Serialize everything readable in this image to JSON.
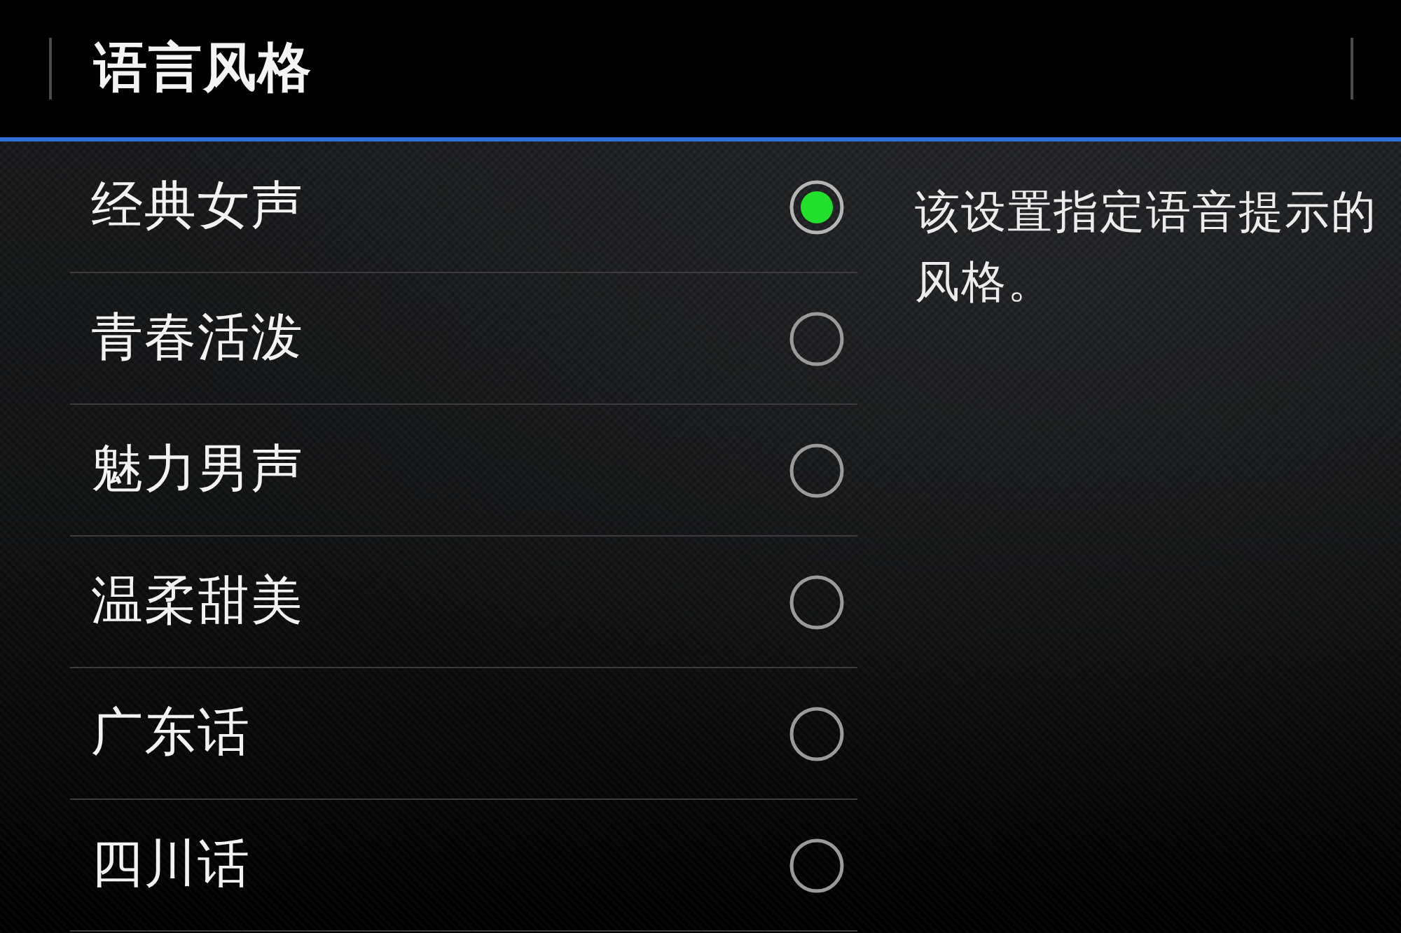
{
  "header": {
    "title": "语言风格"
  },
  "options": [
    {
      "label": "经典女声",
      "selected": true
    },
    {
      "label": "青春活泼",
      "selected": false
    },
    {
      "label": "魅力男声",
      "selected": false
    },
    {
      "label": "温柔甜美",
      "selected": false
    },
    {
      "label": "广东话",
      "selected": false
    },
    {
      "label": "四川话",
      "selected": false
    }
  ],
  "description": {
    "lines": [
      "该设置指定语音提示的",
      "风格。"
    ]
  }
}
